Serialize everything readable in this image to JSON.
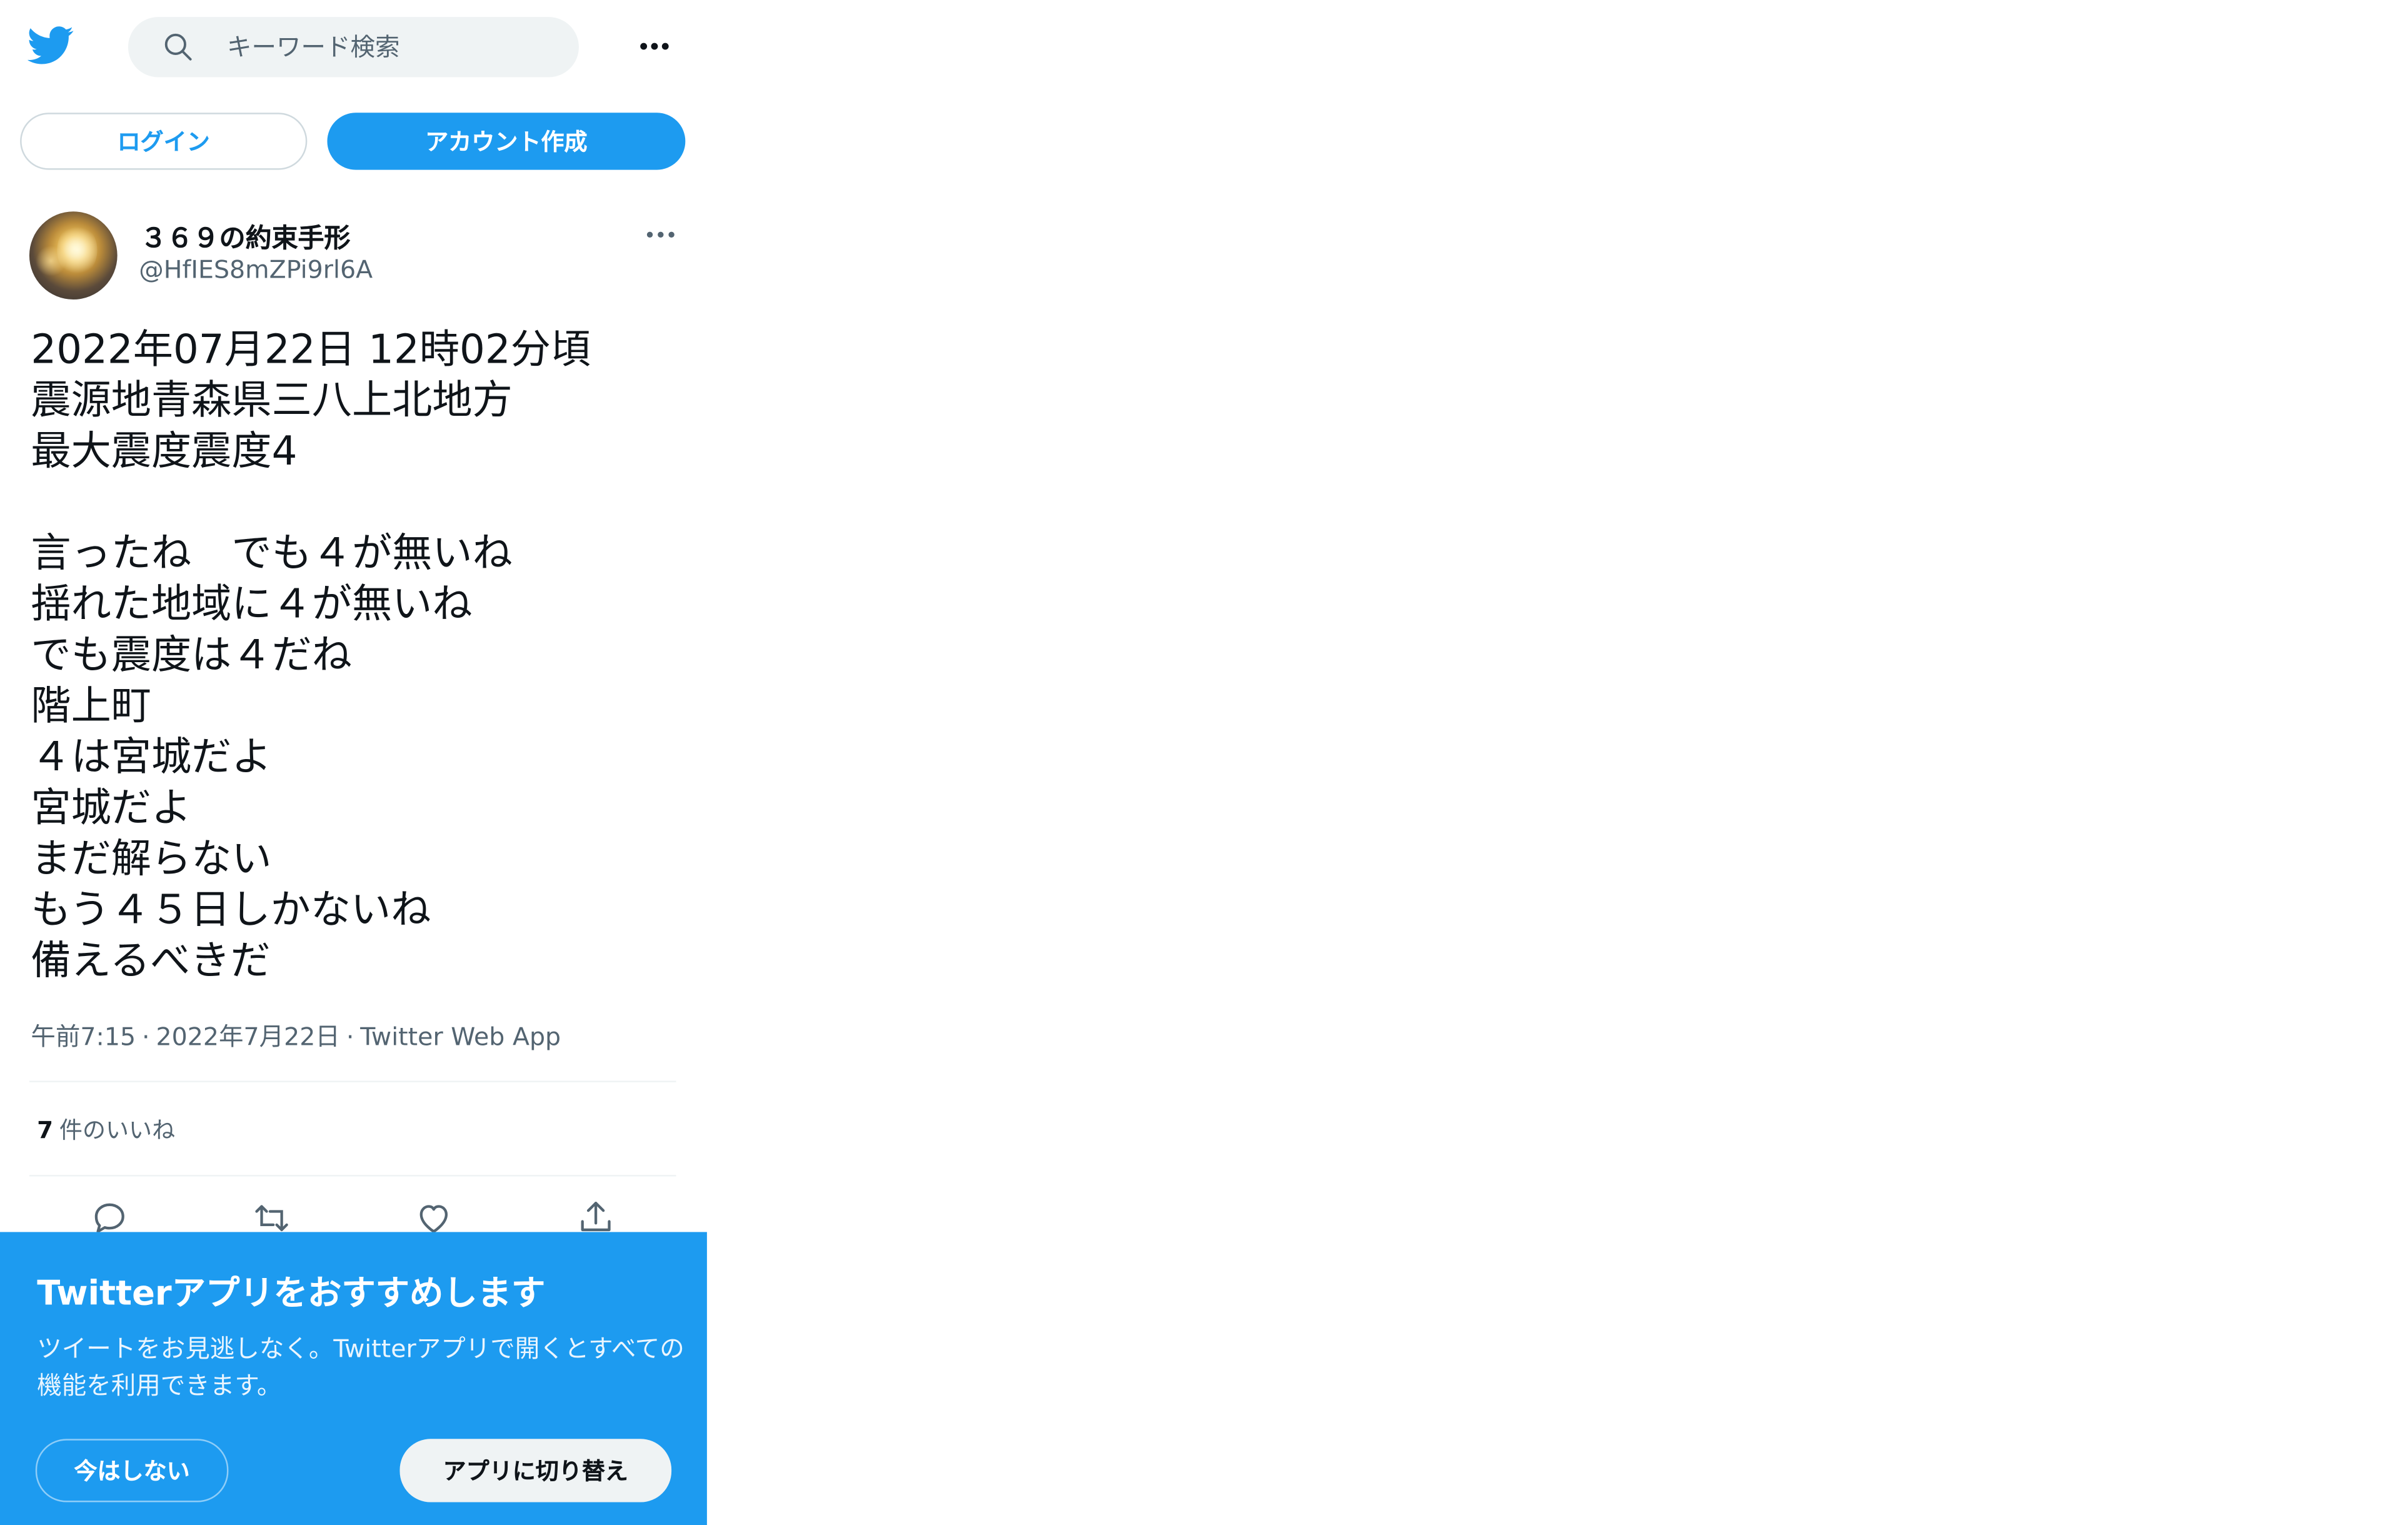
{
  "header": {
    "search_placeholder": "キーワード検索",
    "logo_icon": "twitter-bird-icon",
    "more_icon": "more-horizontal-icon"
  },
  "auth": {
    "login_label": "ログイン",
    "signup_label": "アカウント作成"
  },
  "tweet": {
    "author_name": "３６９の約束手形",
    "author_handle": "@HfIES8mZPi9rl6A",
    "text": "2022年07月22日 12時02分頃\n震源地青森県三八上北地方\n最大震度震度4\n\n言ったね　でも４が無いね\n揺れた地域に４が無いね\nでも震度は４だね\n階上町\n４は宮城だよ\n宮城だよ\nまだ解らない\nもう４５日しかないね\n備えるべきだ",
    "time": "午前7:15",
    "date": "2022年7月22日",
    "source": "Twitter Web App",
    "separator": "·",
    "likes_count": "7",
    "likes_label": "件のいいね",
    "actions": [
      "reply-icon",
      "retweet-icon",
      "like-icon",
      "share-icon"
    ]
  },
  "banner": {
    "title": "Twitterアプリをおすすめします",
    "body": "ツイートをお見逃しなく。Twitterアプリで開くとすべての機能を利用できます。",
    "not_now_label": "今はしない",
    "switch_label": "アプリに切り替え"
  },
  "colors": {
    "brand": "#1d9bf0",
    "text": "#0f1419",
    "secondary": "#536471",
    "search_bg": "#eff3f4"
  }
}
